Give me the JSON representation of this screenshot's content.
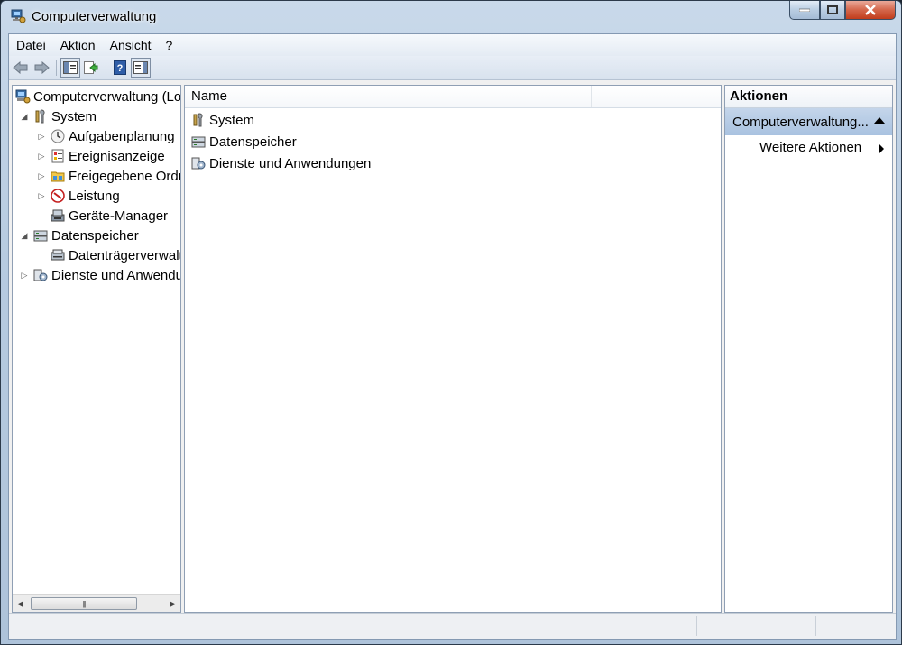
{
  "window": {
    "title": "Computerverwaltung"
  },
  "menu": {
    "items": [
      "Datei",
      "Aktion",
      "Ansicht",
      "?"
    ]
  },
  "tree": {
    "root": "Computerverwaltung (Lo",
    "nodes": [
      {
        "label": "System",
        "icon": "tools-icon",
        "level": 1,
        "expander": "expanded"
      },
      {
        "label": "Aufgabenplanung",
        "icon": "clock-icon",
        "level": 2,
        "expander": "collapsed"
      },
      {
        "label": "Ereignisanzeige",
        "icon": "event-viewer-icon",
        "level": 2,
        "expander": "collapsed"
      },
      {
        "label": "Freigegebene Ordn",
        "icon": "shared-folder-icon",
        "level": 2,
        "expander": "collapsed"
      },
      {
        "label": "Leistung",
        "icon": "performance-icon",
        "level": 2,
        "expander": "collapsed"
      },
      {
        "label": "Geräte-Manager",
        "icon": "device-manager-icon",
        "level": 2,
        "expander": "none"
      },
      {
        "label": "Datenspeicher",
        "icon": "storage-icon",
        "level": 1,
        "expander": "expanded"
      },
      {
        "label": "Datenträgerverwalt",
        "icon": "disk-icon",
        "level": 2,
        "expander": "none"
      },
      {
        "label": "Dienste und Anwendu",
        "icon": "services-icon",
        "level": 1,
        "expander": "collapsed"
      }
    ]
  },
  "list": {
    "column_name": "Name",
    "rows": [
      {
        "label": "System",
        "icon": "tools-icon"
      },
      {
        "label": "Datenspeicher",
        "icon": "storage-icon"
      },
      {
        "label": "Dienste und Anwendungen",
        "icon": "services-icon"
      }
    ]
  },
  "actions": {
    "header": "Aktionen",
    "section": "Computerverwaltung...",
    "item": "Weitere Aktionen"
  }
}
